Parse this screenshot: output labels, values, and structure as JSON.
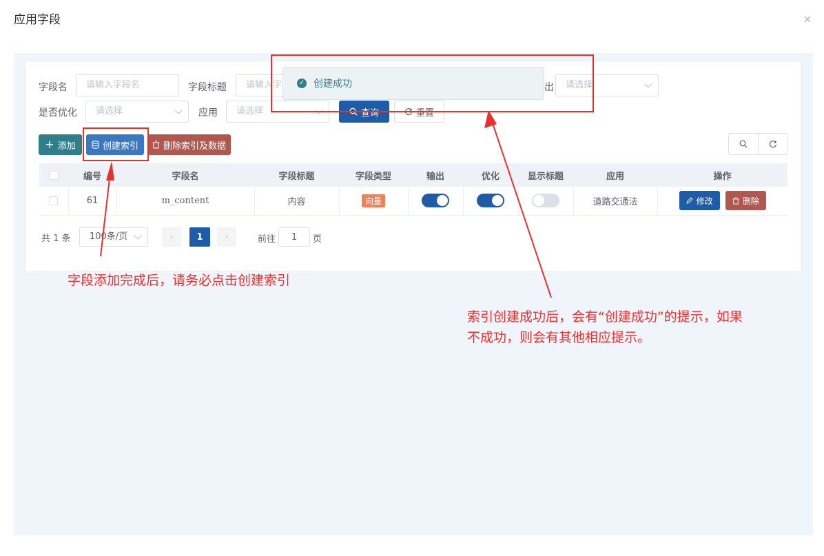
{
  "dialog": {
    "title": "应用字段",
    "close_glyph": "×"
  },
  "filters": {
    "field_name_label": "字段名",
    "field_name_placeholder": "请输入字段名",
    "field_title_label": "字段标题",
    "field_title_placeholder": "请输入字",
    "output_label_partial": "出",
    "output_placeholder": "请选择",
    "optimize_label": "是否优化",
    "optimize_placeholder": "请选择",
    "app_label": "应用",
    "app_placeholder": "请选择",
    "query_button": "查询",
    "reset_button": "重置"
  },
  "toolbar": {
    "add_label": "添加",
    "create_index_label": "创建索引",
    "delete_index_label": "删除索引及数据"
  },
  "table": {
    "headers": [
      "编号",
      "字段名",
      "字段标题",
      "字段类型",
      "输出",
      "优化",
      "显示标题",
      "应用",
      "操作"
    ],
    "rows": [
      {
        "id": "61",
        "field_name": "m_content",
        "field_title": "内容",
        "field_type": "向量",
        "output": true,
        "optimize": true,
        "show_title": false,
        "app": "道路交通法",
        "edit_label": "修改",
        "delete_label": "删除"
      }
    ]
  },
  "pagination": {
    "total": "共 1 条",
    "page_size": "100条/页",
    "current_page": "1",
    "goto_prefix": "前往",
    "goto_value": "1",
    "goto_suffix": "页"
  },
  "toast": {
    "message": "创建成功"
  },
  "annotations": {
    "note_left": "字段添加完成后，请务必点击创建索引",
    "note_right_line1": "索引创建成功后，会有“创建成功”的提示，如果",
    "note_right_line2": "不成功，则会有其他相应提示。"
  },
  "colors": {
    "primary": "#1f5ca8",
    "teal": "#2f7f8a",
    "danger": "#b0574f",
    "annotation": "#e8312c",
    "tag": "#e8835a"
  }
}
